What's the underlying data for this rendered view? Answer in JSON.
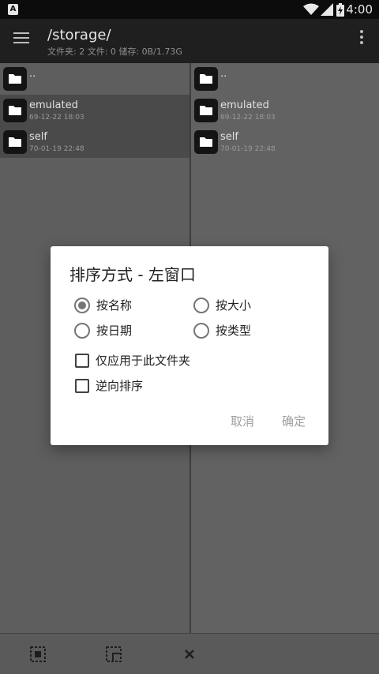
{
  "status_bar": {
    "time": "4:00"
  },
  "toolbar": {
    "title": "/storage/",
    "subtitle": "文件夹: 2  文件: 0  储存: 0B/1.73G"
  },
  "left_pane": {
    "rows": [
      {
        "name": "..",
        "date": ""
      },
      {
        "name": "emulated",
        "date": "69-12-22 18:03"
      },
      {
        "name": "self",
        "date": "70-01-19 22:48"
      }
    ]
  },
  "right_pane": {
    "rows": [
      {
        "name": "..",
        "date": ""
      },
      {
        "name": "emulated",
        "date": "69-12-22 18:03"
      },
      {
        "name": "self",
        "date": "70-01-19 22:48"
      }
    ]
  },
  "dialog": {
    "title": "排序方式 - 左窗口",
    "sort_options": [
      {
        "label": "按名称",
        "checked": true
      },
      {
        "label": "按大小",
        "checked": false
      },
      {
        "label": "按日期",
        "checked": false
      },
      {
        "label": "按类型",
        "checked": false
      }
    ],
    "checkboxes": [
      {
        "label": "仅应用于此文件夹",
        "checked": false
      },
      {
        "label": "逆向排序",
        "checked": false
      }
    ],
    "cancel_label": "取消",
    "ok_label": "确定"
  },
  "icons": [
    "menu-icon",
    "more-vert-icon",
    "folder-icon",
    "select-all-icon",
    "select-range-icon",
    "close-icon",
    "wifi-icon",
    "signal-icon",
    "battery-icon"
  ]
}
